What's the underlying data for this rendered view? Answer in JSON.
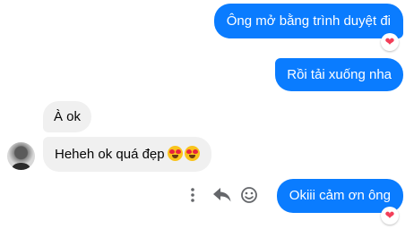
{
  "messages": [
    {
      "id": "msg1",
      "side": "sent",
      "text": "Ông mở bằng trình duyệt đi",
      "reaction": "heart"
    },
    {
      "id": "msg2",
      "side": "sent",
      "text": "Rồi tải xuống nha"
    },
    {
      "id": "msg3",
      "side": "received",
      "text": "À ok"
    },
    {
      "id": "msg4",
      "side": "received",
      "text": "Heheh ok quá đẹp",
      "emoji": [
        "heart-eyes",
        "heart-eyes"
      ]
    },
    {
      "id": "msg5",
      "side": "sent",
      "text": "Okiii cảm ơn ông",
      "reaction": "heart"
    }
  ],
  "message_actions": [
    "more-icon",
    "reply-icon",
    "emoji-react-icon"
  ],
  "colors": {
    "sent_bubble": "#0a7cff",
    "received_bubble": "#f0f0f0",
    "reaction_heart": "#f33e58",
    "action_icon": "#65676b"
  }
}
